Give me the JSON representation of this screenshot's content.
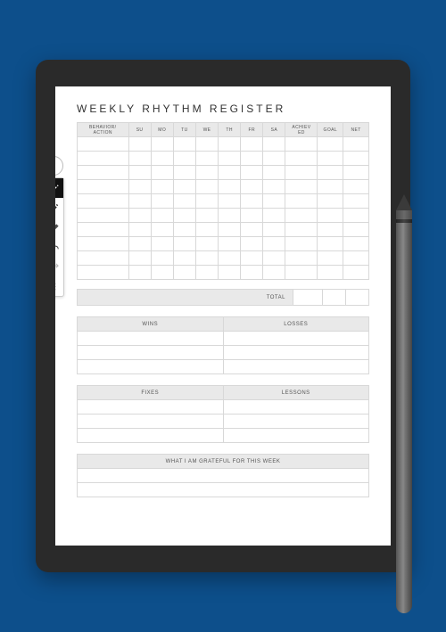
{
  "title": "WEEKLY RHYTHM REGISTER",
  "columns": {
    "behavior": "BEHAVIOR/\nACTION",
    "days": [
      "SU",
      "MO",
      "TU",
      "WE",
      "TH",
      "FR",
      "SA"
    ],
    "achieved": "ACHIEV\nED",
    "goal": "GOAL",
    "net": "NET"
  },
  "tracker_rows": 10,
  "total_label": "TOTAL",
  "sections_top": {
    "left": "WINS",
    "right": "LOSSES",
    "rows": 3
  },
  "sections_bottom": {
    "left": "FIXES",
    "right": "LESSONS",
    "rows": 3
  },
  "grateful": {
    "label": "WHAT I AM GRATEFUL FOR THIS WEEK",
    "rows": 2
  },
  "toolbar": {
    "collapse": "⌃",
    "tools": [
      {
        "name": "pen-icon",
        "active": true
      },
      {
        "name": "highlighter-icon",
        "active": false
      },
      {
        "name": "eraser-icon",
        "active": false
      },
      {
        "name": "undo-icon",
        "active": false
      },
      {
        "name": "redo-icon",
        "active": false
      },
      {
        "name": "more-icon",
        "active": false
      }
    ]
  }
}
